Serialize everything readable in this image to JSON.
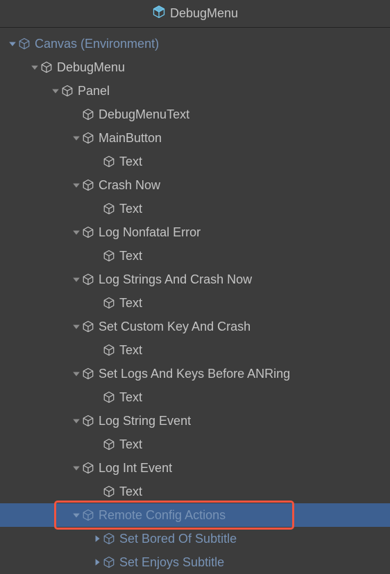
{
  "header": {
    "title": "DebugMenu"
  },
  "colors": {
    "headerCube": "#70C8EE",
    "prefabText": "#7893B6",
    "normalText": "#C4C4C4",
    "selectedBg": "#3D6091",
    "highlight": "#F1543F"
  },
  "tree": [
    {
      "indent": 0,
      "arrow": "down",
      "label": "Canvas (Environment)",
      "style": "prefab",
      "selected": false,
      "highlighted": false
    },
    {
      "indent": 1,
      "arrow": "down",
      "label": "DebugMenu",
      "style": "normal",
      "selected": false,
      "highlighted": false
    },
    {
      "indent": 2,
      "arrow": "down",
      "label": "Panel",
      "style": "normal",
      "selected": false,
      "highlighted": false
    },
    {
      "indent": 3,
      "arrow": "none",
      "label": "DebugMenuText",
      "style": "normal",
      "selected": false,
      "highlighted": false
    },
    {
      "indent": 3,
      "arrow": "down",
      "label": "MainButton",
      "style": "normal",
      "selected": false,
      "highlighted": false
    },
    {
      "indent": 4,
      "arrow": "none",
      "label": "Text",
      "style": "normal",
      "selected": false,
      "highlighted": false
    },
    {
      "indent": 3,
      "arrow": "down",
      "label": "Crash Now",
      "style": "normal",
      "selected": false,
      "highlighted": false
    },
    {
      "indent": 4,
      "arrow": "none",
      "label": "Text",
      "style": "normal",
      "selected": false,
      "highlighted": false
    },
    {
      "indent": 3,
      "arrow": "down",
      "label": "Log Nonfatal Error",
      "style": "normal",
      "selected": false,
      "highlighted": false
    },
    {
      "indent": 4,
      "arrow": "none",
      "label": "Text",
      "style": "normal",
      "selected": false,
      "highlighted": false
    },
    {
      "indent": 3,
      "arrow": "down",
      "label": "Log Strings And Crash Now",
      "style": "normal",
      "selected": false,
      "highlighted": false
    },
    {
      "indent": 4,
      "arrow": "none",
      "label": "Text",
      "style": "normal",
      "selected": false,
      "highlighted": false
    },
    {
      "indent": 3,
      "arrow": "down",
      "label": "Set Custom Key And Crash",
      "style": "normal",
      "selected": false,
      "highlighted": false
    },
    {
      "indent": 4,
      "arrow": "none",
      "label": "Text",
      "style": "normal",
      "selected": false,
      "highlighted": false
    },
    {
      "indent": 3,
      "arrow": "down",
      "label": "Set Logs And Keys Before ANRing",
      "style": "normal",
      "selected": false,
      "highlighted": false
    },
    {
      "indent": 4,
      "arrow": "none",
      "label": "Text",
      "style": "normal",
      "selected": false,
      "highlighted": false
    },
    {
      "indent": 3,
      "arrow": "down",
      "label": "Log String Event",
      "style": "normal",
      "selected": false,
      "highlighted": false
    },
    {
      "indent": 4,
      "arrow": "none",
      "label": "Text",
      "style": "normal",
      "selected": false,
      "highlighted": false
    },
    {
      "indent": 3,
      "arrow": "down",
      "label": "Log Int Event",
      "style": "normal",
      "selected": false,
      "highlighted": false
    },
    {
      "indent": 4,
      "arrow": "none",
      "label": "Text",
      "style": "normal",
      "selected": false,
      "highlighted": false
    },
    {
      "indent": 3,
      "arrow": "down",
      "label": "Remote Config Actions",
      "style": "prefab",
      "selected": true,
      "highlighted": true
    },
    {
      "indent": 4,
      "arrow": "right",
      "label": "Set Bored Of Subtitle",
      "style": "prefab",
      "selected": false,
      "highlighted": false
    },
    {
      "indent": 4,
      "arrow": "right",
      "label": "Set Enjoys Subtitle",
      "style": "prefab",
      "selected": false,
      "highlighted": false
    }
  ]
}
